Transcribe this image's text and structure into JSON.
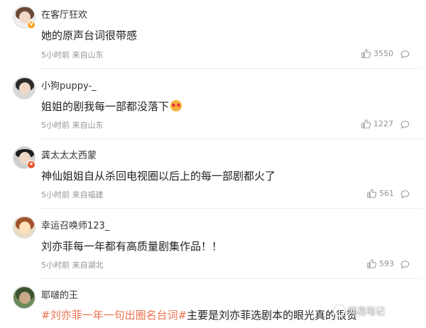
{
  "comments": [
    {
      "username": "在客厅狂欢",
      "text": "她的原声台词很带感",
      "meta": "5小时前 来自山东",
      "likes": "3550",
      "avatar_icon": "girl-avatar",
      "badge_icon": "verified-badge-icon",
      "badge_color": "#f5a623"
    },
    {
      "username": "小狗puppy-_",
      "text": "姐姐的剧我每一部都没落下",
      "emoji": "heart-eyes-emoji",
      "meta": "5小时前 来自山东",
      "likes": "1227",
      "avatar_icon": "girl-avatar"
    },
    {
      "username": "龚太太太西蒙",
      "text": "神仙姐姐自从杀回电视圈以后上的每一部剧都火了",
      "meta": "5小时前 来自福建",
      "likes": "561",
      "avatar_icon": "boy-avatar",
      "badge_icon": "member-badge-icon",
      "badge_color": "#e8542f"
    },
    {
      "username": "幸运召唤师123_",
      "text": "刘亦菲每一年都有高质量剧集作品！！",
      "meta": "5小时前 来自湖北",
      "likes": "593",
      "avatar_icon": "cartoon-avatar"
    },
    {
      "username": "耶啵的王",
      "text_topic": "#刘亦菲一年一句出圈名台词#",
      "text": "主要是刘亦菲选剧本的眼光真的很赞",
      "avatar_icon": "outdoor-avatar"
    }
  ],
  "icons": {
    "like": "thumbs-up-icon",
    "reply": "comment-bubble-icon"
  },
  "watermark": {
    "label": "网易笔记"
  },
  "colors": {
    "topic": "#eb7350",
    "meta": "#939393"
  }
}
